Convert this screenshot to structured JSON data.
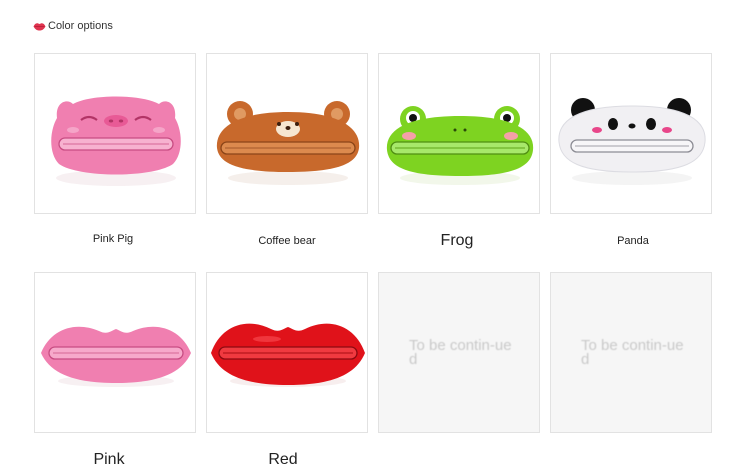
{
  "header": {
    "icon": "lips-icon",
    "title": "Color options"
  },
  "products": [
    {
      "label": "Pink Pig",
      "image": "pink-pig-tube-squeezer"
    },
    {
      "label": "Coffee bear",
      "image": "coffee-bear-tube-squeezer"
    },
    {
      "label": "Frog",
      "image": "frog-tube-squeezer"
    },
    {
      "label": "Panda",
      "image": "panda-tube-squeezer"
    },
    {
      "label": "Pink",
      "image": "pink-lips-tube-squeezer"
    },
    {
      "label": "Red",
      "image": "red-lips-tube-squeezer"
    }
  ],
  "placeholders": [
    {
      "text": "To be contin-ued"
    },
    {
      "text": "To be contin-ued"
    }
  ],
  "colors": {
    "pink": "#f07fb0",
    "brown": "#c8692c",
    "frog": "#7ed321",
    "panda": "#f1f0f3",
    "red": "#e0121a"
  }
}
